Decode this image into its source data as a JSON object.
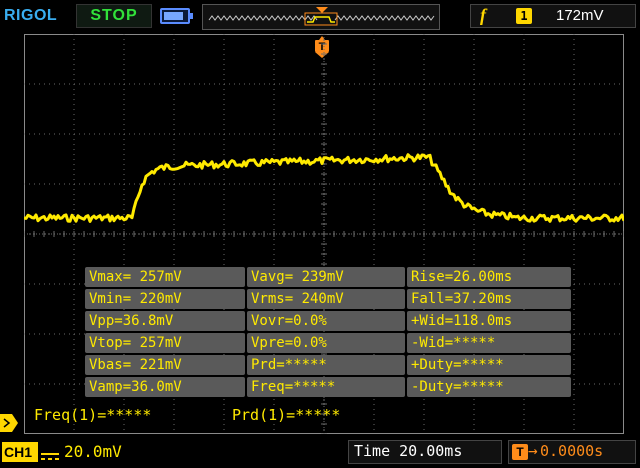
{
  "header": {
    "brand": "RIGOL",
    "run_status": "STOP",
    "trigger_edge_symbol": "f",
    "trigger_channel": "1",
    "trigger_level": "172mV"
  },
  "trigger_marker": "T",
  "measurements": {
    "rows": [
      [
        "Vmax= 257mV",
        "Vavg= 239mV",
        "Rise=26.00ms"
      ],
      [
        "Vmin= 220mV",
        "Vrms= 240mV",
        "Fall=37.20ms"
      ],
      [
        "Vpp=36.8mV",
        "Vovr=0.0%",
        "+Wid=118.0ms"
      ],
      [
        "Vtop= 257mV",
        "Vpre=0.0%",
        "-Wid=*****"
      ],
      [
        "Vbas= 221mV",
        "Prd=*****",
        "+Duty=*****"
      ],
      [
        "Vamp=36.0mV",
        "Freq=*****",
        "-Duty=*****"
      ]
    ]
  },
  "readouts": {
    "freq": "Freq(1)=*****",
    "prd": "Prd(1)=*****"
  },
  "footer": {
    "channel_label": "CH1",
    "channel_scale": "20.0mV",
    "time_scale": "Time 20.00ms",
    "offset_icon": "T",
    "offset_arrow": "→",
    "time_offset": "0.0000s"
  },
  "colors": {
    "trace": "#ffea00",
    "brand": "#39aef0",
    "status": "#31e13a",
    "grid": "#6a6a6a",
    "measure_bg": "#5a5a5a",
    "offset": "#ff8c1a"
  },
  "icons": [
    "battery-icon",
    "memory-bar-icon",
    "trigger-position-icon",
    "trigger-edge-icon",
    "channel-ground-marker-icon",
    "dc-coupling-icon"
  ]
}
